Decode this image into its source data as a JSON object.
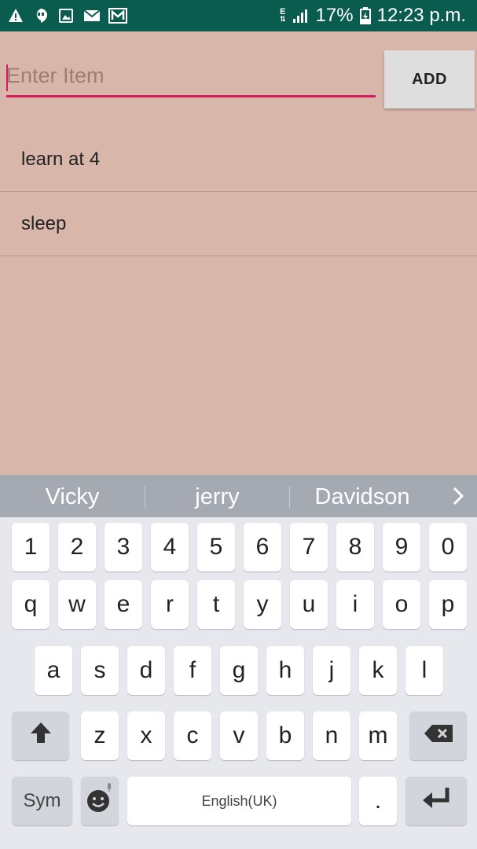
{
  "status_bar": {
    "icons_left": [
      "warning-icon",
      "hangouts-icon",
      "image-icon",
      "email-icon",
      "gmail-icon"
    ],
    "network_type": "E",
    "battery": "17%",
    "time": "12:23 p.m.",
    "background_color": "#0a5c4f"
  },
  "input": {
    "placeholder": "Enter Item",
    "value": "",
    "underline_color": "#d81b60"
  },
  "add_button": {
    "label": "ADD"
  },
  "items": [
    {
      "text": "learn at 4"
    },
    {
      "text": "sleep"
    }
  ],
  "keyboard": {
    "suggestions": [
      "Vicky",
      "jerry",
      "Davidson"
    ],
    "row_numbers": [
      "1",
      "2",
      "3",
      "4",
      "5",
      "6",
      "7",
      "8",
      "9",
      "0"
    ],
    "row1": [
      "q",
      "w",
      "e",
      "r",
      "t",
      "y",
      "u",
      "i",
      "o",
      "p"
    ],
    "row2": [
      "a",
      "s",
      "d",
      "f",
      "g",
      "h",
      "j",
      "k",
      "l"
    ],
    "row3": [
      "z",
      "x",
      "c",
      "v",
      "b",
      "n",
      "m"
    ],
    "sym_label": "Sym",
    "space_label": "English(UK)",
    "period_label": "."
  },
  "colors": {
    "app_background": "#d9b6aa",
    "suggestion_bar": "#a5a9b2",
    "keyboard_background": "#e6e8ee"
  }
}
